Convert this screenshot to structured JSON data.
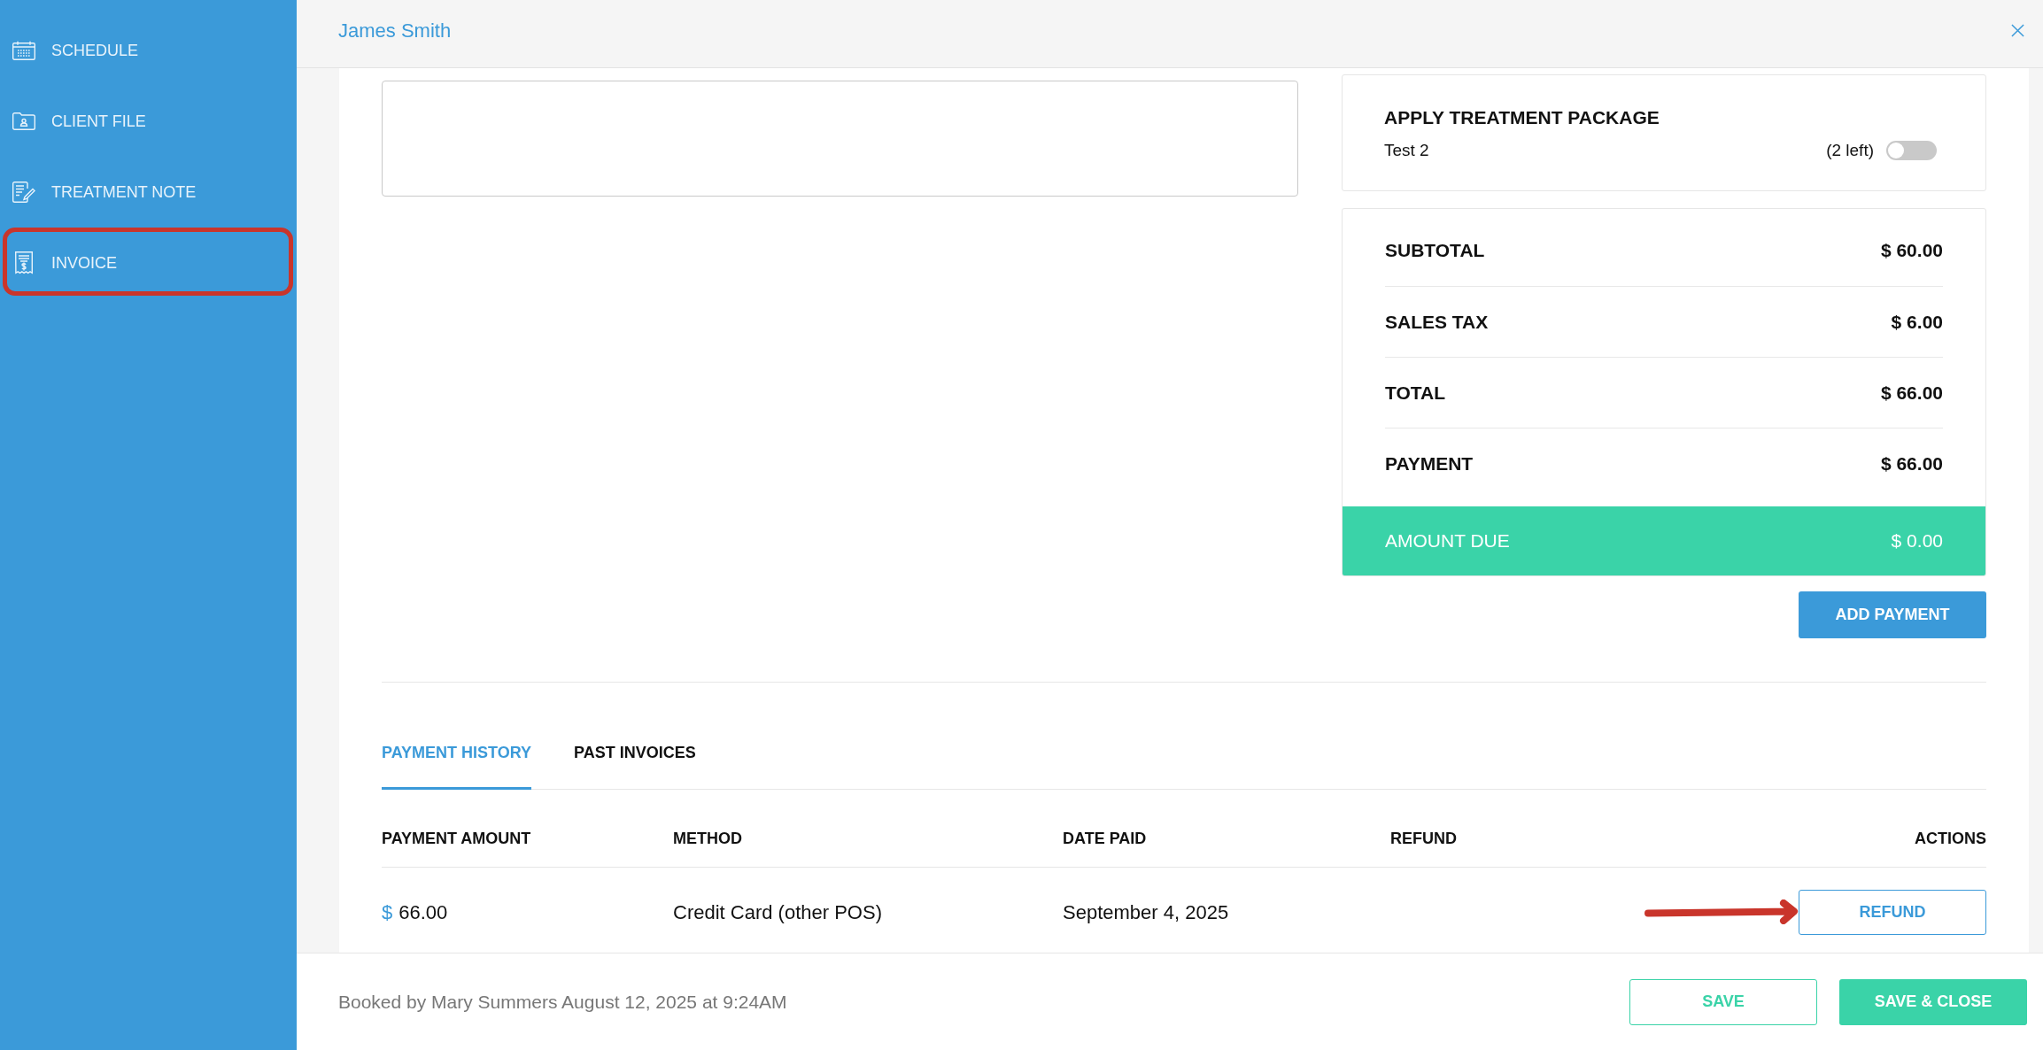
{
  "sidebar": {
    "items": [
      {
        "label": "SCHEDULE",
        "highlighted": false
      },
      {
        "label": "CLIENT FILE",
        "highlighted": false
      },
      {
        "label": "TREATMENT NOTE",
        "highlighted": false
      },
      {
        "label": "INVOICE",
        "highlighted": true
      }
    ]
  },
  "header": {
    "title": "James Smith"
  },
  "treatment_package": {
    "title": "APPLY TREATMENT PACKAGE",
    "package_name": "Test 2",
    "remaining": "(2 left)",
    "on": false
  },
  "totals": [
    {
      "kind": "line",
      "label": "SUBTOTAL",
      "value": "$ 60.00"
    },
    {
      "kind": "line",
      "label": "SALES TAX",
      "value": "$ 6.00"
    },
    {
      "kind": "line",
      "label": "TOTAL",
      "value": "$ 66.00"
    },
    {
      "kind": "line",
      "label": "PAYMENT",
      "value": "$ 66.00"
    },
    {
      "kind": "due",
      "label": "AMOUNT DUE",
      "value": "$ 0.00"
    }
  ],
  "add_payment_button": "ADD PAYMENT",
  "tabs": [
    {
      "label": "PAYMENT HISTORY",
      "selected": true
    },
    {
      "label": "PAST INVOICES",
      "selected": false
    }
  ],
  "table": {
    "columns": [
      "PAYMENT AMOUNT",
      "METHOD",
      "DATE PAID",
      "REFUND",
      "ACTIONS"
    ],
    "rows": [
      {
        "currency": "$",
        "amount": "66.00",
        "method": "Credit Card (other POS)",
        "date_paid": "September 4, 2025",
        "action": "REFUND",
        "arrow": true
      }
    ]
  },
  "footer": {
    "booked_by": "Booked by Mary Summers August 12, 2025 at 9:24AM",
    "buttons": [
      {
        "kind": "outline",
        "label": "SAVE"
      },
      {
        "kind": "filled",
        "label": "SAVE & CLOSE"
      }
    ]
  }
}
